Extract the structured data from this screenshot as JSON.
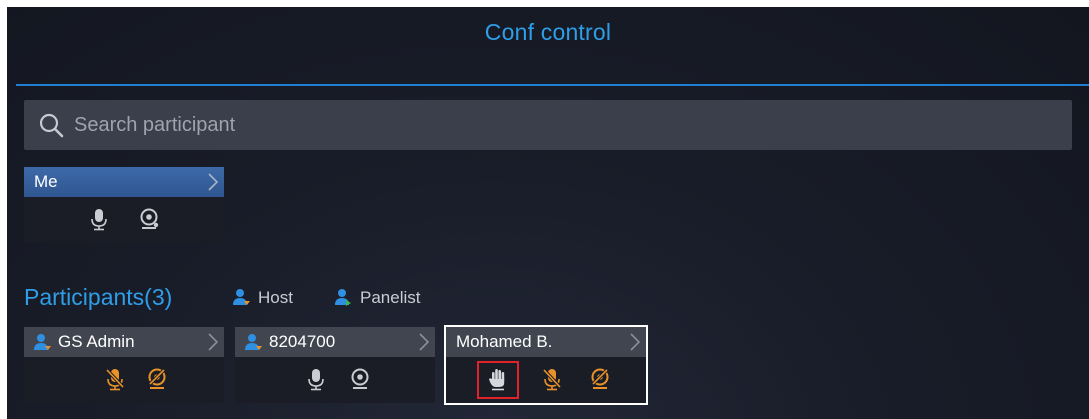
{
  "header": {
    "title": "Conf control"
  },
  "search": {
    "placeholder": "Search participant",
    "value": ""
  },
  "me_card": {
    "name": "Me",
    "controls": [
      "microphone-icon",
      "camera-icon"
    ]
  },
  "participants": {
    "label": "Participants(3)",
    "legend": [
      {
        "label": "Host",
        "icon": "host-person-icon",
        "color": "#2f8fe0"
      },
      {
        "label": "Panelist",
        "icon": "panelist-person-icon",
        "color": "#2f8fe0"
      }
    ],
    "items": [
      {
        "name": "GS Admin",
        "role": "host",
        "controls": [
          "mic-muted-icon",
          "camera-disabled-icon"
        ],
        "selected": false
      },
      {
        "name": "8204700",
        "role": "host",
        "controls": [
          "microphone-icon",
          "camera-icon"
        ],
        "selected": false
      },
      {
        "name": "Mohamed B.",
        "role": "",
        "controls": [
          "raise-hand-icon",
          "mic-muted-icon",
          "camera-disabled-icon"
        ],
        "selected": true
      }
    ]
  },
  "colors": {
    "accent": "#2f9ee8",
    "muted_orange": "#e8922a",
    "highlight_red": "#e0232a",
    "card_header": "#40454f",
    "me_header": "#2f5690"
  }
}
